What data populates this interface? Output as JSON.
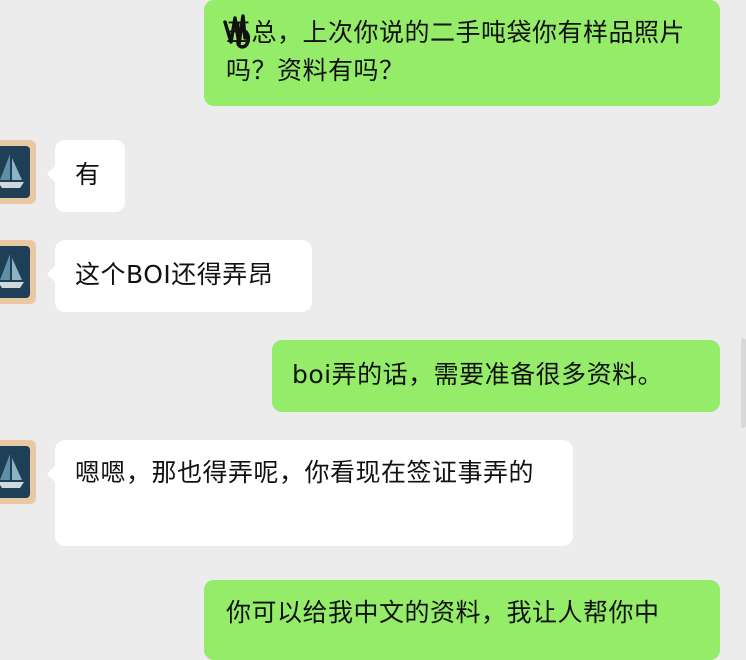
{
  "chat": {
    "messages": [
      {
        "side": "out",
        "text": "王总，上次你说的二手吨袋你有样品照片吗？资料有吗？"
      },
      {
        "side": "in",
        "text": "有"
      },
      {
        "side": "in",
        "text": "这个BOI还得弄昂"
      },
      {
        "side": "out",
        "text": "boi弄的话，需要准备很多资料。"
      },
      {
        "side": "in",
        "text": "嗯嗯，那也得弄呢，你看现在签证事弄的"
      },
      {
        "side": "out",
        "text": "你可以给我中文的资料，我让人帮你中"
      }
    ],
    "avatar_icon": "sailboat-icon"
  },
  "colors": {
    "background": "#ececec",
    "outgoing_bubble": "#95ec69",
    "incoming_bubble": "#ffffff"
  }
}
